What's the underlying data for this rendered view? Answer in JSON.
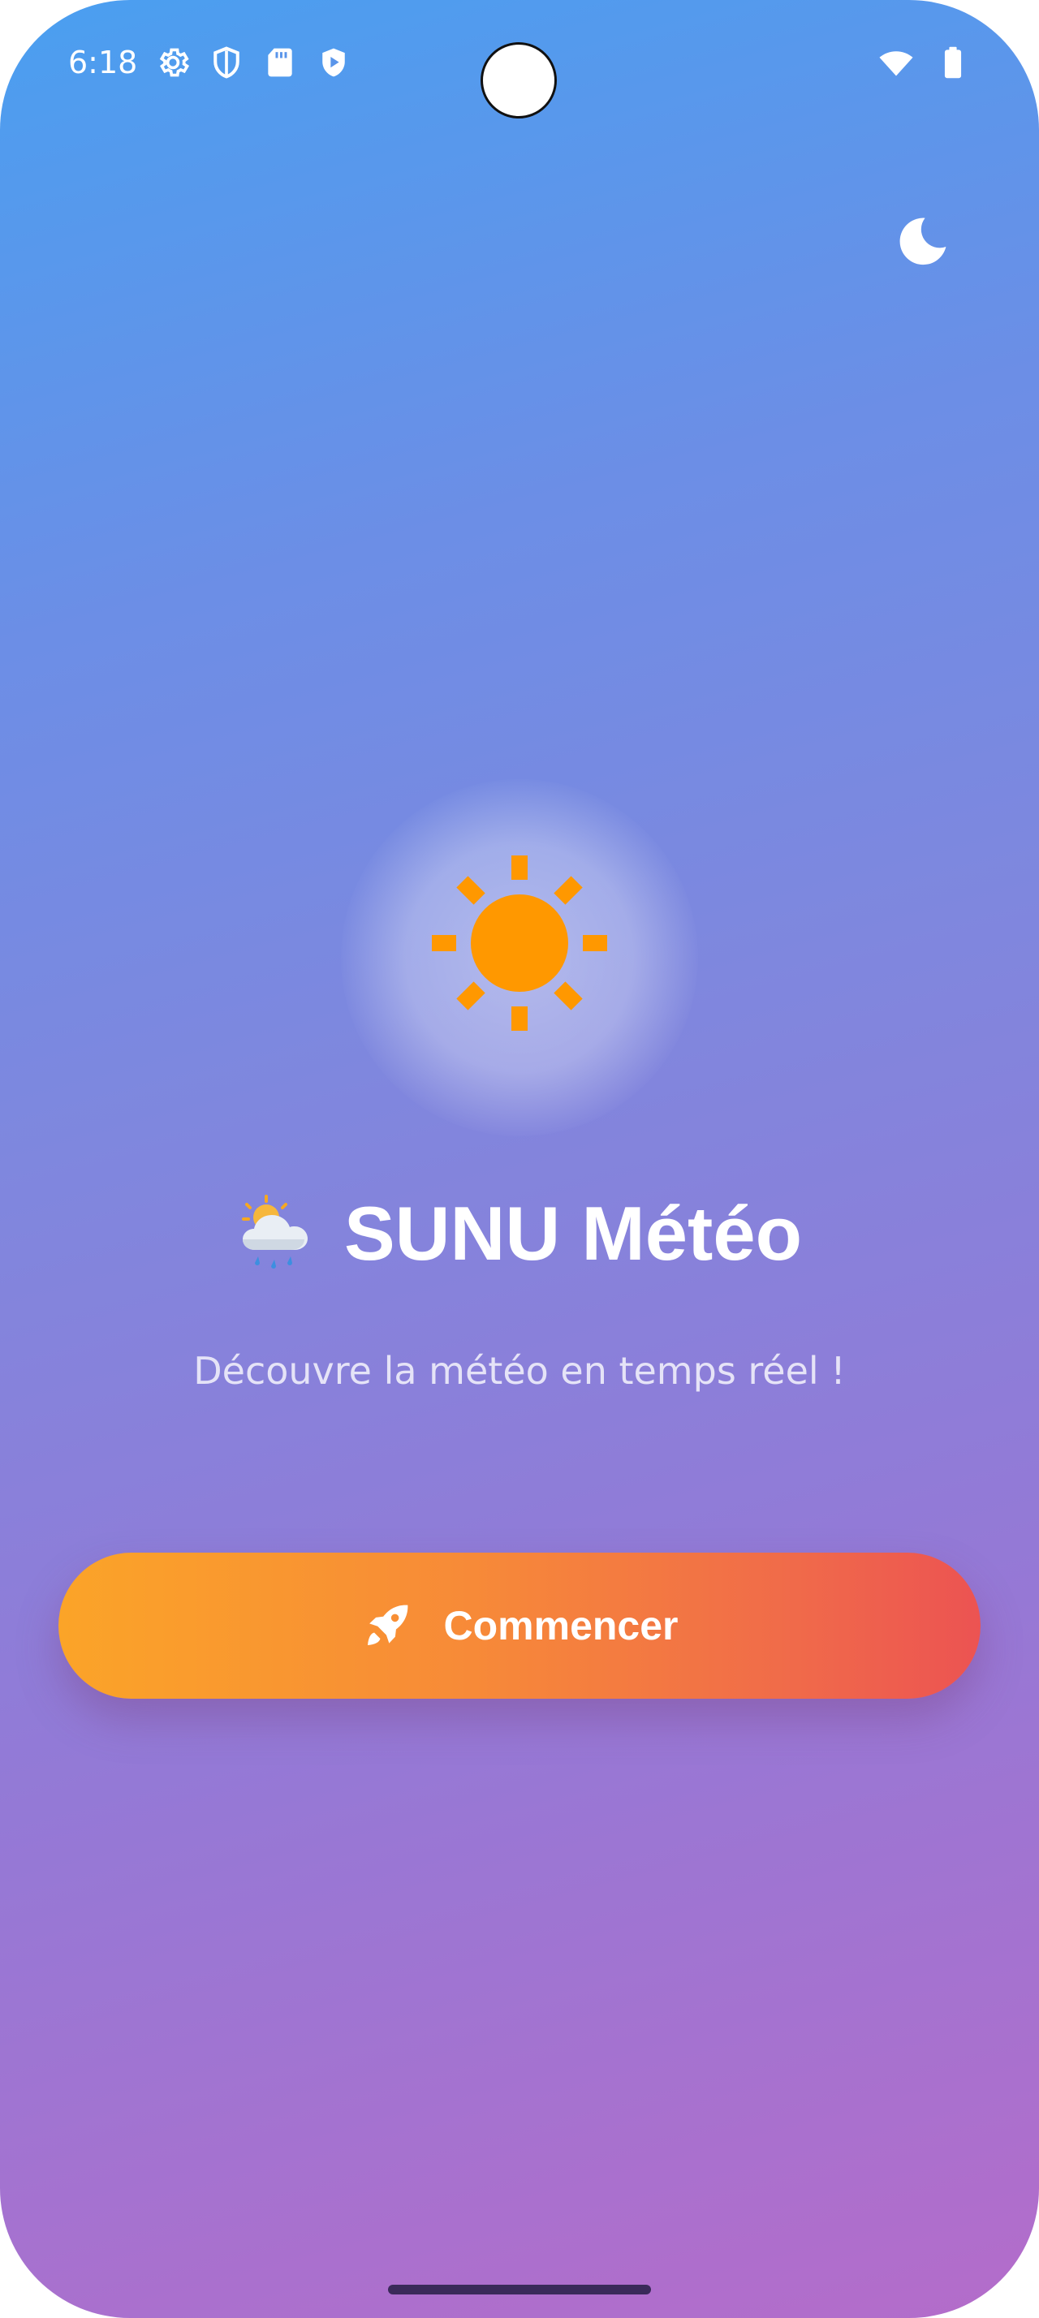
{
  "status_bar": {
    "time": "6:18",
    "icons": [
      "gear-icon",
      "shield-icon",
      "sd-card-icon",
      "play-shield-icon",
      "wifi-icon",
      "battery-icon"
    ]
  },
  "header": {
    "theme_toggle_icon": "moon-icon"
  },
  "hero": {
    "icon": "sun-icon",
    "title_emoji": "sun-behind-rain-cloud-icon",
    "title": "SUNU Météo",
    "subtitle": "Découvre la météo en temps réel !"
  },
  "actions": {
    "start_icon": "rocket-icon",
    "start_label": "Commencer"
  },
  "colors": {
    "gradient_top": "#4a9ff0",
    "gradient_bottom": "#b46cca",
    "sun": "#ff9800",
    "button_start": "#fba428",
    "button_end": "#ec5352"
  }
}
